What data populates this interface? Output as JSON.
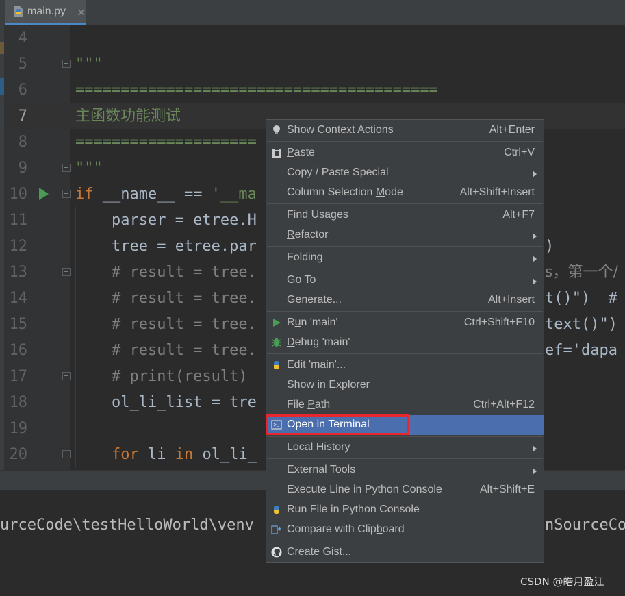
{
  "tab": {
    "filename": "main.py",
    "close_icon": "close-icon",
    "file_icon": "python-file-icon"
  },
  "editor": {
    "line_numbers": [
      "4",
      "5",
      "6",
      "7",
      "8",
      "9",
      "10",
      "11",
      "12",
      "13",
      "14",
      "15",
      "16",
      "17",
      "18",
      "19",
      "20"
    ],
    "current_line": "7",
    "lines": {
      "l5": "\"\"\"",
      "l6": "========================================",
      "l7": "主函数功能测试",
      "l8": "====================",
      "l9": "\"\"\"",
      "l10_kw": "if",
      "l10_rest": " __name__ == ",
      "l10_str": "'__ma",
      "l11": "    parser = etree.H",
      "l12a": "    tree = etree.par",
      "l12b": ")",
      "l13a": "    # result = tree.",
      "l13b": "s，第一个/",
      "l14a": "    # result = tree.",
      "l14b": "t()\")  #",
      "l15a": "    # result = tree.",
      "l15b": "text()\")",
      "l16a": "    # result = tree.",
      "l16b": "ef='dapa",
      "l17": "    # print(result)",
      "l18": "    ol_li_list = tre",
      "l20_kw1": "for",
      "l20_mid": " li ",
      "l20_kw2": "in",
      "l20_rest": " ol_li_"
    }
  },
  "terminal": {
    "left_text": "urceCode\\testHelloWorld\\venv",
    "right_text": "nSourceCo"
  },
  "watermark": "CSDN @皓月盈江",
  "context_menu": {
    "items": [
      {
        "label": "Show Context Actions",
        "shortcut": "Alt+Enter"
      },
      {
        "label_pre": "",
        "label_u": "P",
        "label_post": "aste",
        "shortcut": "Ctrl+V"
      },
      {
        "label": "Copy / Paste Special"
      },
      {
        "label_pre": "Column Selection ",
        "label_u": "M",
        "label_post": "ode",
        "shortcut": "Alt+Shift+Insert"
      },
      {
        "label_pre": "Find ",
        "label_u": "U",
        "label_post": "sages",
        "shortcut": "Alt+F7"
      },
      {
        "label_pre": "",
        "label_u": "R",
        "label_post": "efactor"
      },
      {
        "label": "Folding"
      },
      {
        "label": "Go To"
      },
      {
        "label": "Generate...",
        "shortcut": "Alt+Insert"
      },
      {
        "label_pre": "R",
        "label_u": "u",
        "label_post": "n 'main'",
        "shortcut": "Ctrl+Shift+F10"
      },
      {
        "label_pre": "",
        "label_u": "D",
        "label_post": "ebug 'main'"
      },
      {
        "label": "Edit 'main'..."
      },
      {
        "label": "Show in Explorer"
      },
      {
        "label_pre": "File ",
        "label_u": "P",
        "label_post": "ath",
        "shortcut": "Ctrl+Alt+F12"
      },
      {
        "label": "Open in Terminal"
      },
      {
        "label_pre": "Local ",
        "label_u": "H",
        "label_post": "istory"
      },
      {
        "label": "External Tools"
      },
      {
        "label": "Execute Line in Python Console",
        "shortcut": "Alt+Shift+E"
      },
      {
        "label": "Run File in Python Console"
      },
      {
        "label_pre": "Compare with Clip",
        "label_u": "b",
        "label_post": "oard"
      },
      {
        "label": "Create Gist..."
      }
    ]
  },
  "colors": {
    "selection": "#4b6eaf",
    "highlight_box": "#e8262b",
    "keyword": "#cc7832",
    "string": "#6a8759",
    "comment": "#808080"
  }
}
